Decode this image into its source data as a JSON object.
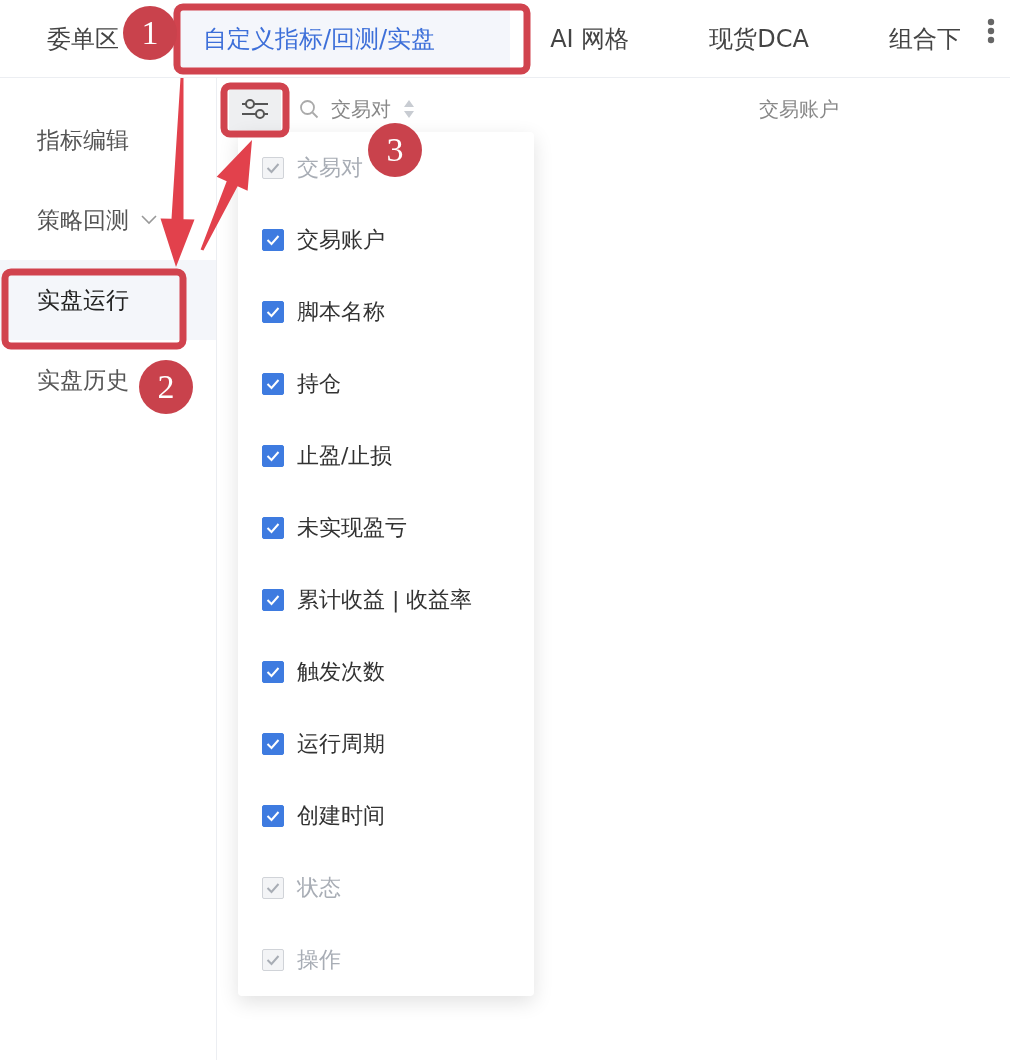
{
  "tabs": [
    {
      "label": "委单区",
      "selected": false
    },
    {
      "label": "自定义指标/回测/实盘",
      "selected": true
    },
    {
      "label": "AI 网格",
      "selected": false
    },
    {
      "label": "现货DCA",
      "selected": false
    },
    {
      "label": "组合下",
      "selected": false
    }
  ],
  "sidebar": {
    "items": [
      {
        "label": "指标编辑",
        "selected": false,
        "expandable": false
      },
      {
        "label": "策略回测",
        "selected": false,
        "expandable": true
      },
      {
        "label": "实盘运行",
        "selected": true,
        "expandable": false
      },
      {
        "label": "实盘历史",
        "selected": false,
        "expandable": false
      }
    ]
  },
  "table": {
    "columns": [
      {
        "label": "交易对",
        "sortable": true,
        "searchable": true
      },
      {
        "label": "交易账户"
      }
    ]
  },
  "column_menu": {
    "items": [
      {
        "label": "交易对",
        "checked": true,
        "disabled": true
      },
      {
        "label": "交易账户",
        "checked": true,
        "disabled": false
      },
      {
        "label": "脚本名称",
        "checked": true,
        "disabled": false
      },
      {
        "label": "持仓",
        "checked": true,
        "disabled": false
      },
      {
        "label": "止盈/止损",
        "checked": true,
        "disabled": false
      },
      {
        "label": "未实现盈亏",
        "checked": true,
        "disabled": false
      },
      {
        "label": "累计收益 | 收益率",
        "checked": true,
        "disabled": false
      },
      {
        "label": "触发次数",
        "checked": true,
        "disabled": false
      },
      {
        "label": "运行周期",
        "checked": true,
        "disabled": false
      },
      {
        "label": "创建时间",
        "checked": true,
        "disabled": false
      },
      {
        "label": "状态",
        "checked": true,
        "disabled": true
      },
      {
        "label": "操作",
        "checked": true,
        "disabled": true
      }
    ]
  },
  "annotations": {
    "badges": [
      "1",
      "2",
      "3"
    ]
  }
}
